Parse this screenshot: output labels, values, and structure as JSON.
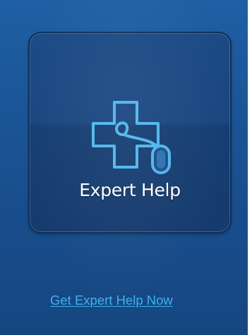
{
  "card": {
    "label": "Expert Help",
    "icon": "medical-cross-mouse-icon"
  },
  "link": {
    "text": "Get Expert Help Now"
  },
  "colors": {
    "background": "#1b5698",
    "card": "#1a4680",
    "icon_stroke": "#4fb6ec",
    "link": "#3fb2ec",
    "label": "#ffffff"
  }
}
